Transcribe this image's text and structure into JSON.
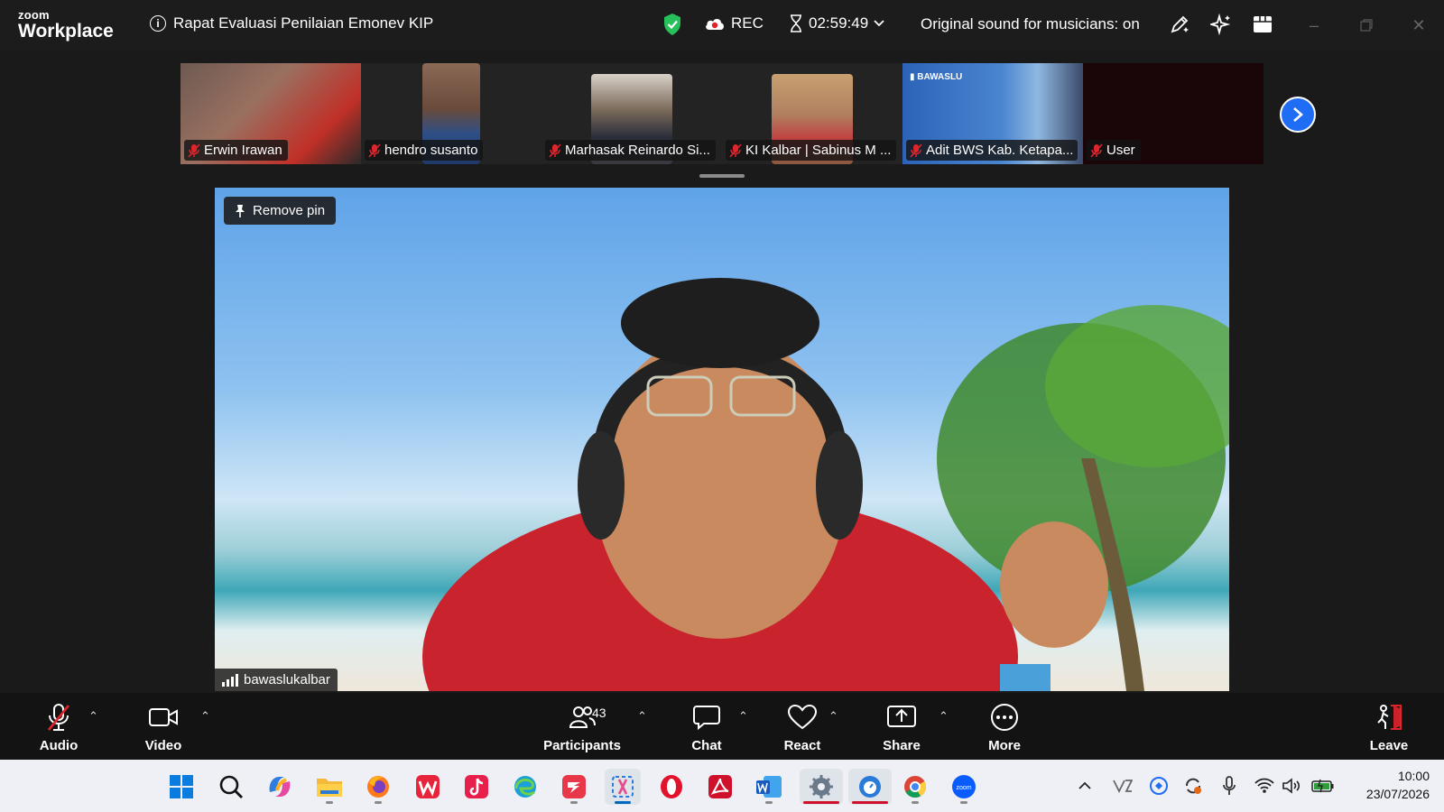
{
  "app": {
    "logo_small": "zoom",
    "logo_big": "Workplace"
  },
  "titlebar": {
    "meeting_title": "Rapat Evaluasi Penilaian Emonev KIP",
    "rec_label": "REC",
    "timer": "02:59:49",
    "original_sound": "Original sound for musicians: on"
  },
  "participants_strip": [
    {
      "name": "Erwin Irawan",
      "tone": "#8b5a4a"
    },
    {
      "name": "hendro susanto",
      "tone": "#3a5e8a"
    },
    {
      "name": "Marhasak Reinardo Si...",
      "tone": "#4a4a55"
    },
    {
      "name": "KI Kalbar | Sabinus M ...",
      "tone": "#b08a60"
    },
    {
      "name": "Adit BWS Kab. Ketapa...",
      "tone": "#2c63b8"
    },
    {
      "name": "User",
      "tone": "#1a0508"
    }
  ],
  "main_video": {
    "remove_pin": "Remove pin",
    "speaker_name": "bawaslukalbar"
  },
  "toolbar": {
    "audio": "Audio",
    "video": "Video",
    "participants": "Participants",
    "participants_count": "43",
    "chat": "Chat",
    "react": "React",
    "share": "Share",
    "more": "More",
    "leave": "Leave"
  },
  "taskbar": {
    "time": "10:00",
    "date": "23/07/2026"
  },
  "colors": {
    "accent_blue": "#1f6cf5",
    "muted_red": "#e0242c",
    "shield_green": "#26c15b"
  }
}
